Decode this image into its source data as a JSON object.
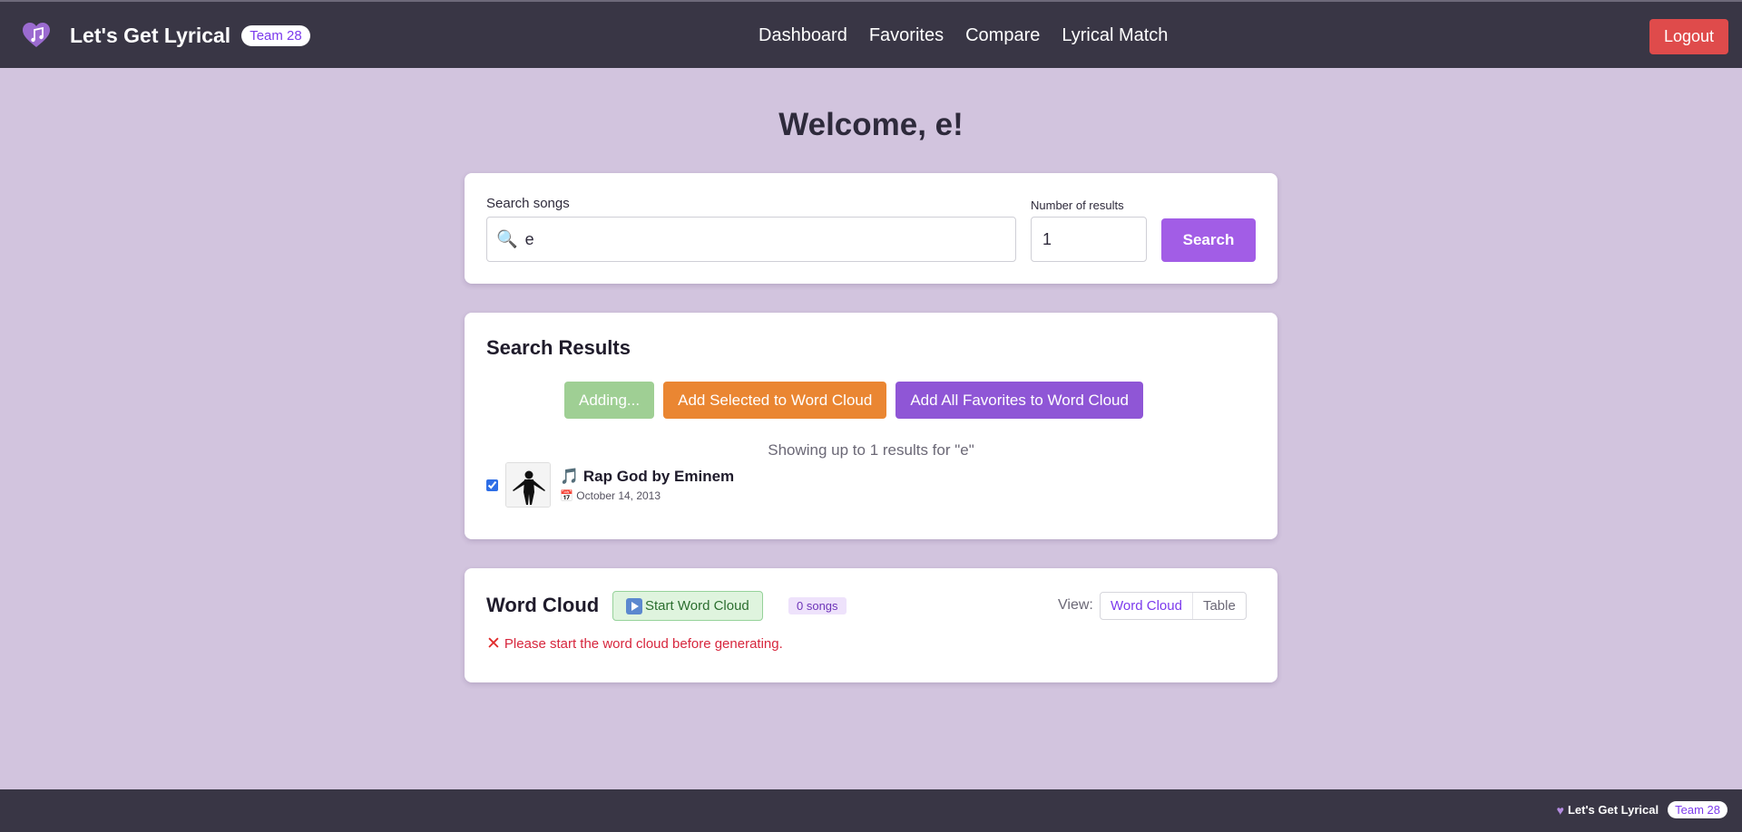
{
  "header": {
    "brand_name": "Let's Get Lyrical",
    "team_badge": "Team 28",
    "nav": [
      "Dashboard",
      "Favorites",
      "Compare",
      "Lyrical Match"
    ],
    "logout_label": "Logout"
  },
  "main": {
    "welcome": "Welcome, e!",
    "search": {
      "label": "Search songs",
      "value": "e",
      "count_label": "Number of results",
      "count_value": "1",
      "button_label": "Search"
    },
    "results": {
      "title": "Search Results",
      "adding_label": "Adding...",
      "add_selected_label": "Add Selected to Word Cloud",
      "add_favorites_label": "Add All Favorites to Word Cloud",
      "showing_text": "Showing up to 1 results for \"e\"",
      "items": [
        {
          "title": "Rap God by Eminem",
          "date": "October 14, 2013",
          "checked": true
        }
      ]
    },
    "word_cloud": {
      "title": "Word Cloud",
      "start_label": "Start Word Cloud",
      "count_badge": "0 songs",
      "view_label": "View:",
      "view_options": [
        "Word Cloud",
        "Table"
      ],
      "active_view": "Word Cloud",
      "error_message": "Please start the word cloud before generating."
    }
  },
  "footer": {
    "brand_name": "Let's Get Lyrical",
    "team_badge": "Team 28"
  },
  "colors": {
    "header_bg": "#393645",
    "page_bg": "#d2c4de",
    "accent": "#a25de6",
    "logout": "#df4b4b",
    "orange": "#ea8632",
    "error": "#d7263d"
  }
}
